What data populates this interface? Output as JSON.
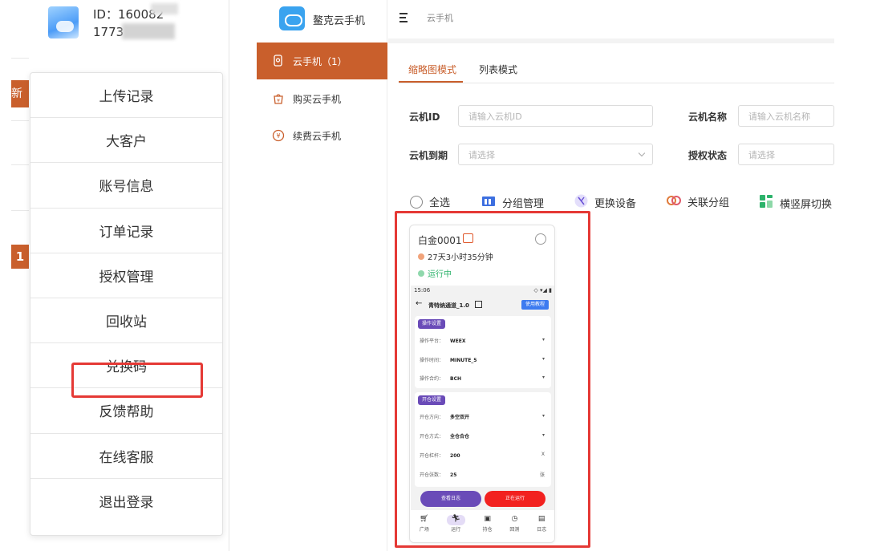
{
  "user": {
    "id_text": "ID：160082",
    "phone_text": "1773"
  },
  "left_fragments": {
    "tag": "新云",
    "number": "1"
  },
  "account_menu": {
    "items": [
      "上传记录",
      "大客户",
      "账号信息",
      "订单记录",
      "授权管理",
      "回收站",
      "兑换码",
      "反馈帮助",
      "在线客服",
      "退出登录"
    ],
    "highlighted": "兑换码"
  },
  "brand": {
    "name": "鳌克云手机",
    "accent": "#c95f2c",
    "logo_color": "#3aa3ef"
  },
  "sidebar": {
    "items": [
      {
        "label": "云手机（1）",
        "icon": "phone-person-icon",
        "active": true
      },
      {
        "label": "购买云手机",
        "icon": "shopping-bag-icon",
        "active": false
      },
      {
        "label": "续费云手机",
        "icon": "renew-yen-icon",
        "active": false
      }
    ]
  },
  "header": {
    "breadcrumb": "云手机"
  },
  "tabs": [
    {
      "label": "缩略图模式",
      "active": true
    },
    {
      "label": "列表模式",
      "active": false
    }
  ],
  "filters": {
    "cloud_id": {
      "label": "云机ID",
      "placeholder": "请输入云机ID"
    },
    "cloud_name": {
      "label": "云机名称",
      "placeholder": "请输入云机名称"
    },
    "expiry": {
      "label": "云机到期",
      "placeholder": "请选择"
    },
    "auth_status": {
      "label": "授权状态",
      "placeholder": "请选择"
    }
  },
  "toolbar": {
    "select_all": "全选",
    "group_manage": "分组管理",
    "change_device": "更换设备",
    "link_group": "关联分组",
    "orientation_toggle": "横竖屏切换"
  },
  "device_card": {
    "name": "白金0001",
    "remaining": "27天3小时35分钟",
    "status": "运行中",
    "status_color": "#2db36b",
    "screen": {
      "clock": "15:06",
      "title": "青特纳通道_1.0",
      "help_button": "使用教程",
      "section1": {
        "badge": "操作设置",
        "rows": [
          {
            "label": "操作平台：",
            "value": "WEEX"
          },
          {
            "label": "操作时间：",
            "value": "MINUTE_5"
          },
          {
            "label": "操作合约：",
            "value": "BCH"
          }
        ]
      },
      "section2": {
        "badge": "开仓设置",
        "rows": [
          {
            "label": "开仓方向：",
            "value": "多空双开",
            "suffix": "▾"
          },
          {
            "label": "开仓方式：",
            "value": "全仓合仓",
            "suffix": "▾"
          },
          {
            "label": "开仓杠杆：",
            "value": "200",
            "suffix": "X"
          },
          {
            "label": "开仓张数：",
            "value": "25",
            "suffix": "张"
          }
        ]
      },
      "btn_log": "查看日志",
      "btn_running": "正在运行",
      "nav": [
        {
          "label": "广场",
          "icon": "cart-icon"
        },
        {
          "label": "运行",
          "icon": "run-icon"
        },
        {
          "label": "持仓",
          "icon": "wallet-icon"
        },
        {
          "label": "回测",
          "icon": "history-icon"
        },
        {
          "label": "日志",
          "icon": "log-icon"
        }
      ]
    }
  }
}
